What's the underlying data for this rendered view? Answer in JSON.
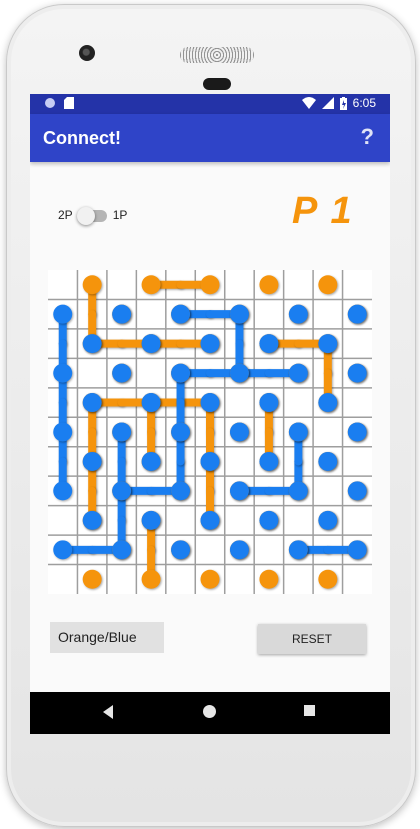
{
  "app": {
    "title": "Connect!",
    "help_label": "?"
  },
  "status_bar": {
    "time": "6:05",
    "icons": [
      "circle-notification-icon",
      "sd-card-icon",
      "wifi-icon",
      "cell-signal-icon",
      "battery-charging-icon"
    ]
  },
  "mode": {
    "left_label": "2P",
    "right_label": "1P",
    "selected": "2P"
  },
  "turn_label": "P 1",
  "board": {
    "size": 11,
    "colors": {
      "orange": "#f5940c",
      "blue": "#1a7ef0",
      "grid": "#9e9e9e"
    },
    "orange_dots": [
      [
        1,
        0
      ],
      [
        3,
        0
      ],
      [
        5,
        0
      ],
      [
        7,
        0
      ],
      [
        9,
        0
      ],
      [
        1,
        2
      ],
      [
        3,
        2
      ],
      [
        5,
        2
      ],
      [
        7,
        2
      ],
      [
        9,
        2
      ],
      [
        1,
        4
      ],
      [
        3,
        4
      ],
      [
        5,
        4
      ],
      [
        7,
        4
      ],
      [
        9,
        4
      ],
      [
        1,
        6
      ],
      [
        3,
        6
      ],
      [
        5,
        6
      ],
      [
        7,
        6
      ],
      [
        9,
        6
      ],
      [
        1,
        8
      ],
      [
        3,
        8
      ],
      [
        5,
        8
      ],
      [
        7,
        8
      ],
      [
        9,
        8
      ],
      [
        1,
        10
      ],
      [
        3,
        10
      ],
      [
        5,
        10
      ],
      [
        7,
        10
      ],
      [
        9,
        10
      ],
      [
        2,
        1
      ],
      [
        4,
        1
      ],
      [
        6,
        1
      ],
      [
        8,
        1
      ],
      [
        10,
        1
      ],
      [
        2,
        3
      ],
      [
        4,
        3
      ],
      [
        6,
        3
      ],
      [
        8,
        3
      ],
      [
        10,
        3
      ],
      [
        2,
        5
      ],
      [
        4,
        5
      ],
      [
        6,
        5
      ],
      [
        8,
        5
      ],
      [
        10,
        5
      ],
      [
        2,
        7
      ],
      [
        4,
        7
      ],
      [
        6,
        7
      ],
      [
        8,
        7
      ],
      [
        10,
        7
      ],
      [
        2,
        9
      ],
      [
        4,
        9
      ],
      [
        6,
        9
      ],
      [
        8,
        9
      ],
      [
        10,
        9
      ]
    ],
    "blue_dots": [
      [
        0,
        1
      ],
      [
        2,
        1
      ],
      [
        4,
        1
      ],
      [
        6,
        1
      ],
      [
        8,
        1
      ],
      [
        10,
        1
      ],
      [
        0,
        3
      ],
      [
        2,
        3
      ],
      [
        4,
        3
      ],
      [
        6,
        3
      ],
      [
        8,
        3
      ],
      [
        10,
        3
      ],
      [
        0,
        5
      ],
      [
        2,
        5
      ],
      [
        4,
        5
      ],
      [
        6,
        5
      ],
      [
        8,
        5
      ],
      [
        10,
        5
      ],
      [
        0,
        7
      ],
      [
        2,
        7
      ],
      [
        4,
        7
      ],
      [
        6,
        7
      ],
      [
        8,
        7
      ],
      [
        10,
        7
      ],
      [
        0,
        9
      ],
      [
        2,
        9
      ],
      [
        4,
        9
      ],
      [
        6,
        9
      ],
      [
        8,
        9
      ],
      [
        10,
        9
      ],
      [
        1,
        2
      ],
      [
        3,
        2
      ],
      [
        5,
        2
      ],
      [
        7,
        2
      ],
      [
        9,
        2
      ],
      [
        1,
        4
      ],
      [
        3,
        4
      ],
      [
        5,
        4
      ],
      [
        7,
        4
      ],
      [
        9,
        4
      ],
      [
        1,
        6
      ],
      [
        3,
        6
      ],
      [
        5,
        6
      ],
      [
        7,
        6
      ],
      [
        9,
        6
      ],
      [
        1,
        8
      ],
      [
        3,
        8
      ],
      [
        5,
        8
      ],
      [
        7,
        8
      ],
      [
        9,
        8
      ]
    ],
    "orange_links": [
      [
        [
          1,
          0
        ],
        [
          1,
          1
        ]
      ],
      [
        [
          1,
          1
        ],
        [
          1,
          2
        ]
      ],
      [
        [
          1,
          2
        ],
        [
          2,
          2
        ]
      ],
      [
        [
          2,
          2
        ],
        [
          3,
          2
        ]
      ],
      [
        [
          3,
          2
        ],
        [
          4,
          2
        ]
      ],
      [
        [
          4,
          2
        ],
        [
          5,
          2
        ]
      ],
      [
        [
          3,
          0
        ],
        [
          4,
          0
        ]
      ],
      [
        [
          4,
          0
        ],
        [
          5,
          0
        ]
      ],
      [
        [
          7,
          2
        ],
        [
          8,
          2
        ]
      ],
      [
        [
          8,
          2
        ],
        [
          9,
          2
        ]
      ],
      [
        [
          9,
          2
        ],
        [
          9,
          3
        ]
      ],
      [
        [
          9,
          3
        ],
        [
          9,
          4
        ]
      ],
      [
        [
          1,
          4
        ],
        [
          2,
          4
        ]
      ],
      [
        [
          2,
          4
        ],
        [
          3,
          4
        ]
      ],
      [
        [
          3,
          4
        ],
        [
          4,
          4
        ]
      ],
      [
        [
          4,
          4
        ],
        [
          5,
          4
        ]
      ],
      [
        [
          1,
          4
        ],
        [
          1,
          5
        ]
      ],
      [
        [
          1,
          5
        ],
        [
          1,
          6
        ]
      ],
      [
        [
          1,
          6
        ],
        [
          1,
          7
        ]
      ],
      [
        [
          1,
          7
        ],
        [
          1,
          8
        ]
      ],
      [
        [
          3,
          4
        ],
        [
          3,
          5
        ]
      ],
      [
        [
          3,
          5
        ],
        [
          3,
          6
        ]
      ],
      [
        [
          5,
          4
        ],
        [
          5,
          5
        ]
      ],
      [
        [
          5,
          5
        ],
        [
          5,
          6
        ]
      ],
      [
        [
          5,
          6
        ],
        [
          5,
          7
        ]
      ],
      [
        [
          5,
          7
        ],
        [
          5,
          8
        ]
      ],
      [
        [
          7,
          4
        ],
        [
          7,
          5
        ]
      ],
      [
        [
          7,
          5
        ],
        [
          7,
          6
        ]
      ],
      [
        [
          3,
          8
        ],
        [
          3,
          9
        ]
      ],
      [
        [
          3,
          9
        ],
        [
          3,
          10
        ]
      ]
    ],
    "blue_links": [
      [
        [
          0,
          1
        ],
        [
          0,
          2
        ]
      ],
      [
        [
          0,
          2
        ],
        [
          0,
          3
        ]
      ],
      [
        [
          0,
          3
        ],
        [
          0,
          4
        ]
      ],
      [
        [
          0,
          4
        ],
        [
          0,
          5
        ]
      ],
      [
        [
          0,
          5
        ],
        [
          0,
          6
        ]
      ],
      [
        [
          0,
          6
        ],
        [
          0,
          7
        ]
      ],
      [
        [
          4,
          1
        ],
        [
          5,
          1
        ]
      ],
      [
        [
          5,
          1
        ],
        [
          6,
          1
        ]
      ],
      [
        [
          6,
          1
        ],
        [
          6,
          2
        ]
      ],
      [
        [
          6,
          2
        ],
        [
          6,
          3
        ]
      ],
      [
        [
          4,
          3
        ],
        [
          5,
          3
        ]
      ],
      [
        [
          5,
          3
        ],
        [
          6,
          3
        ]
      ],
      [
        [
          6,
          3
        ],
        [
          7,
          3
        ]
      ],
      [
        [
          7,
          3
        ],
        [
          8,
          3
        ]
      ],
      [
        [
          4,
          3
        ],
        [
          4,
          4
        ]
      ],
      [
        [
          4,
          4
        ],
        [
          4,
          5
        ]
      ],
      [
        [
          2,
          5
        ],
        [
          2,
          6
        ]
      ],
      [
        [
          2,
          6
        ],
        [
          2,
          7
        ]
      ],
      [
        [
          2,
          7
        ],
        [
          2,
          8
        ]
      ],
      [
        [
          2,
          8
        ],
        [
          2,
          9
        ]
      ],
      [
        [
          2,
          7
        ],
        [
          3,
          7
        ]
      ],
      [
        [
          3,
          7
        ],
        [
          4,
          7
        ]
      ],
      [
        [
          4,
          7
        ],
        [
          4,
          6
        ]
      ],
      [
        [
          4,
          6
        ],
        [
          4,
          5
        ]
      ],
      [
        [
          6,
          7
        ],
        [
          7,
          7
        ]
      ],
      [
        [
          7,
          7
        ],
        [
          8,
          7
        ]
      ],
      [
        [
          8,
          7
        ],
        [
          8,
          6
        ]
      ],
      [
        [
          8,
          6
        ],
        [
          8,
          5
        ]
      ],
      [
        [
          0,
          9
        ],
        [
          1,
          9
        ]
      ],
      [
        [
          1,
          9
        ],
        [
          2,
          9
        ]
      ],
      [
        [
          8,
          9
        ],
        [
          9,
          9
        ]
      ],
      [
        [
          9,
          9
        ],
        [
          10,
          9
        ]
      ]
    ]
  },
  "color_scheme_label": "Orange/Blue",
  "reset_label": "RESET",
  "nav": {
    "back": "back-icon",
    "home": "home-icon",
    "recents": "recents-icon"
  }
}
